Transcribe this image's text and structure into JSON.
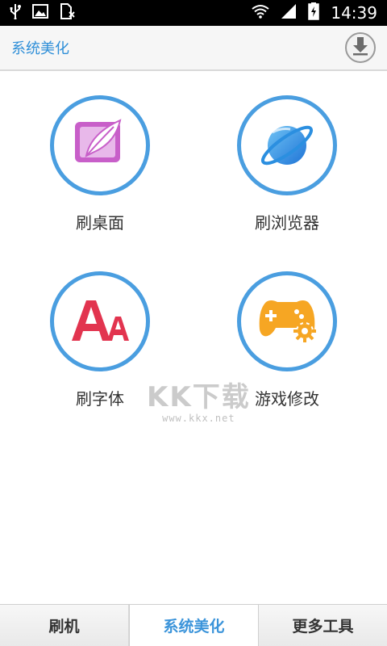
{
  "status_bar": {
    "time": "14:39",
    "icons_left": [
      "usb-icon",
      "image-icon",
      "sim-card-icon"
    ],
    "icons_right": [
      "wifi-icon",
      "signal-icon",
      "battery-icon"
    ]
  },
  "header": {
    "title": "系统美化",
    "action_icon": "download-icon"
  },
  "tiles": [
    {
      "label": "刷桌面",
      "icon": "desktop-feather-icon",
      "color": "#c85fc9"
    },
    {
      "label": "刷浏览器",
      "icon": "browser-planet-icon",
      "color": "#2b8fe0"
    },
    {
      "label": "刷字体",
      "icon": "font-icon",
      "color": "#e2344f"
    },
    {
      "label": "游戏修改",
      "icon": "gamepad-icon",
      "color": "#f6a623"
    }
  ],
  "watermark": {
    "logo": "KK下载",
    "url": "www.kkx.net"
  },
  "bottom_nav": {
    "tabs": [
      {
        "label": "刷机",
        "active": false
      },
      {
        "label": "系统美化",
        "active": true
      },
      {
        "label": "更多工具",
        "active": false
      }
    ]
  },
  "colors": {
    "accent": "#3b94da",
    "circle_border": "#4a9ee0"
  }
}
